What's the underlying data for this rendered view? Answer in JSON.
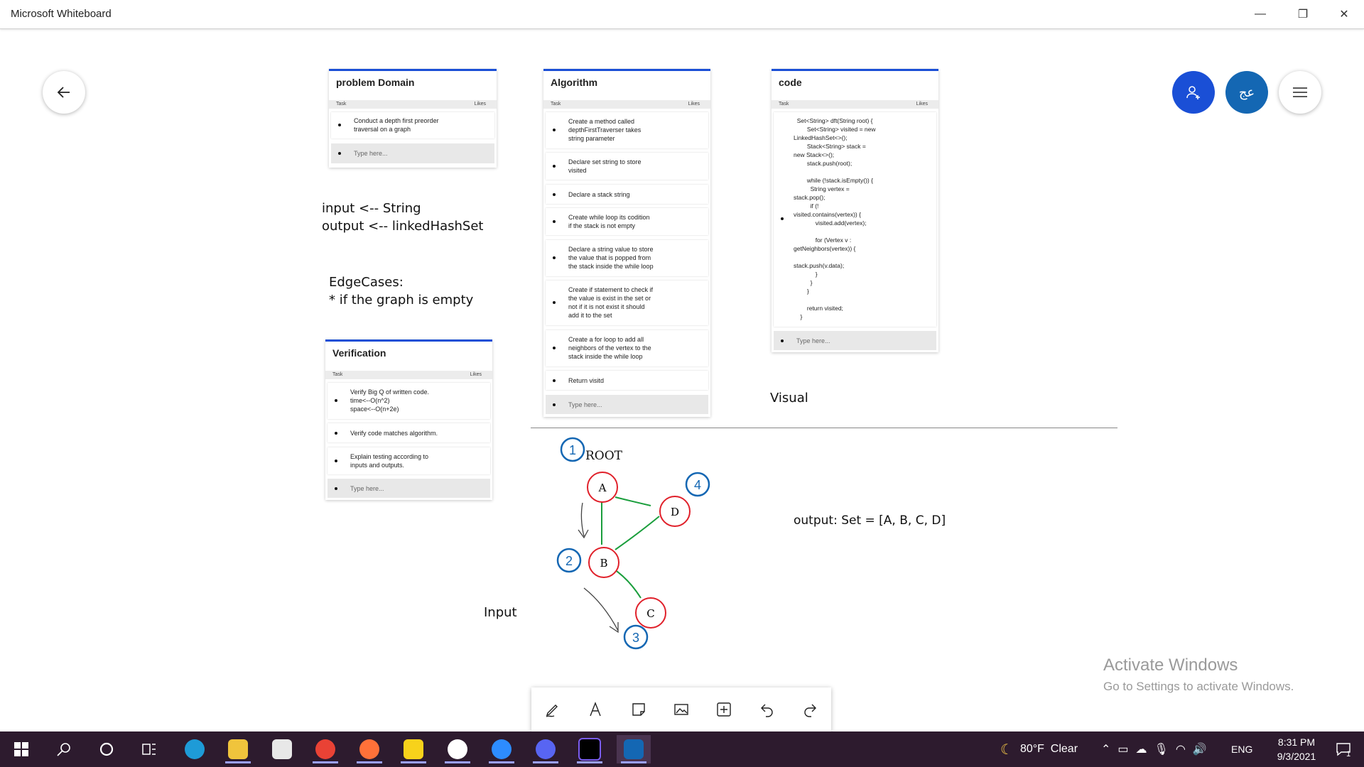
{
  "window": {
    "title": "Microsoft Whiteboard",
    "minimize": "—",
    "restore": "❐",
    "close": "✕"
  },
  "controls": {
    "back_icon": "arrow-left",
    "invite_icon": "person-add",
    "profile_initials": "عج",
    "menu_icon": "hamburger"
  },
  "columns": {
    "task": "Task",
    "likes": "Likes"
  },
  "problem_domain": {
    "title": "problem Domain",
    "items": [
      "Conduct a depth first preorder\ntraversal on a graph"
    ],
    "placeholder": "Type here..."
  },
  "algorithm": {
    "title": "Algorithm",
    "items": [
      "Create a method called\ndepthFirstTraverser takes\nstring parameter",
      "Declare set string to store\nvisited",
      "Declare a stack string",
      "Create while loop its codition\nif the stack is not empty",
      "Declare a string value to store\nthe value that is popped from\nthe stack inside the while loop",
      "Create if statement to check if\nthe value is exist in the set or\nnot if it is not exist it should\nadd it to the set",
      "Create a for loop to add all\nneighbors of the vertex to the\nstack inside the while loop",
      "Return visitd"
    ],
    "placeholder": "Type here..."
  },
  "code": {
    "title": "code",
    "snippet": "  Set<String> dft(String root) {\n        Set<String> visited = new\nLinkedHashSet<>();\n        Stack<String> stack =\nnew Stack<>();\n        stack.push(root);\n\n        while (!stack.isEmpty()) {\n          String vertex =\nstack.pop();\n          if (!\nvisited.contains(vertex)) {\n             visited.add(vertex);\n\n             for (Vertex v :\ngetNeighbors(vertex)) {\n\nstack.push(v.data);\n             }\n          }\n        }\n\n        return visited;\n    }",
    "placeholder": "Type here..."
  },
  "verification": {
    "title": "Verification",
    "items": [
      "Verify Big Q of written code.\ntime<--O(n^2)\nspace<--O(n+2e)",
      "Verify code matches algorithm.",
      "Explain testing according to\ninputs and outputs."
    ],
    "placeholder": "Type here..."
  },
  "notes": {
    "io": "input <-- String\noutput <-- linkedHashSet",
    "edge": "EdgeCases:\n* if the graph is empty",
    "visual": "Visual",
    "output": "output: Set = [A, B, C, D]",
    "input": "Input",
    "root": "ROOT"
  },
  "graph": {
    "nodes": [
      "A",
      "B",
      "C",
      "D"
    ],
    "numbers": [
      "1",
      "2",
      "3",
      "4"
    ],
    "edges": [
      [
        "A",
        "B"
      ],
      [
        "A",
        "D"
      ],
      [
        "B",
        "D"
      ],
      [
        "B",
        "C"
      ]
    ],
    "colors": {
      "node": "#e0202a",
      "edge": "#1a9e3c",
      "number": "#1467b3"
    }
  },
  "watermark": {
    "line1": "Activate Windows",
    "line2": "Go to Settings to activate Windows."
  },
  "toolbar": [
    "pen-icon",
    "text-icon",
    "note-icon",
    "image-icon",
    "add-icon",
    "undo-icon",
    "redo-icon"
  ],
  "taskbar": {
    "weather": "80°F  Clear",
    "lang": "ENG",
    "time": "8:31 PM",
    "date": "9/3/2021",
    "notifications": "1"
  }
}
